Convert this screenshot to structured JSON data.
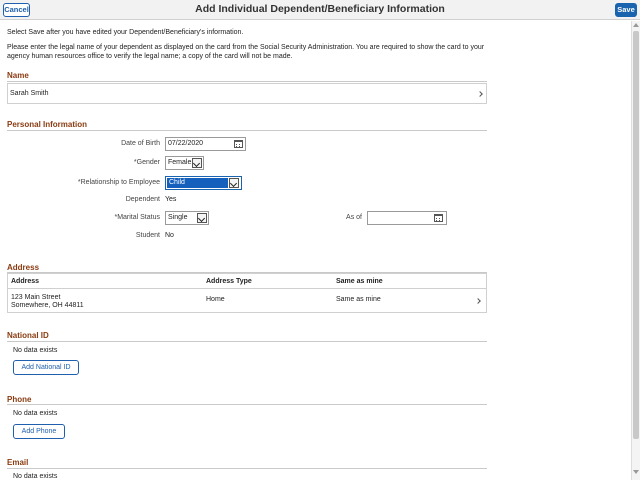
{
  "header": {
    "cancel_label": "Cancel",
    "title": "Add Individual Dependent/Beneficiary Information",
    "save_label": "Save"
  },
  "intro": {
    "line1": "Select Save after you have edited your Dependent/Beneficiary's information.",
    "line2": "Please enter the legal name of your dependent as displayed on the card from the Social Security Administration. You are required to show the card to your",
    "line3": "agency human resources office to verify the legal name; a copy of the card will not be made."
  },
  "name_section": {
    "title": "Name",
    "value": "Sarah Smith"
  },
  "personal": {
    "title": "Personal Information",
    "dob_label": "Date of Birth",
    "dob_value": "07/22/2020",
    "gender_label": "*Gender",
    "gender_value": "Female",
    "relationship_label": "*Relationship to Employee",
    "relationship_value": "Child",
    "dependent_label": "Dependent",
    "dependent_value": "Yes",
    "marital_label": "*Marital Status",
    "marital_value": "Single",
    "asof_label": "As of",
    "asof_value": "",
    "student_label": "Student",
    "student_value": "No"
  },
  "address": {
    "title": "Address",
    "columns": [
      "Address",
      "Address Type",
      "Same as mine"
    ],
    "row": {
      "line1": "123 Main Street",
      "line2": "Somewhere, OH 44811",
      "type": "Home",
      "same": "Same as mine"
    }
  },
  "national_id": {
    "title": "National ID",
    "empty": "No data exists",
    "button": "Add National ID"
  },
  "phone": {
    "title": "Phone",
    "empty": "No data exists",
    "button": "Add Phone"
  },
  "email": {
    "title": "Email",
    "empty": "No data exists"
  },
  "colors": {
    "section_title": "#8a3b10",
    "accent": "#1a63ae",
    "selected_option": "#1560bd"
  },
  "icons": [
    "calendar-icon",
    "dropdown-arrow-icon",
    "chevron-right-icon"
  ]
}
